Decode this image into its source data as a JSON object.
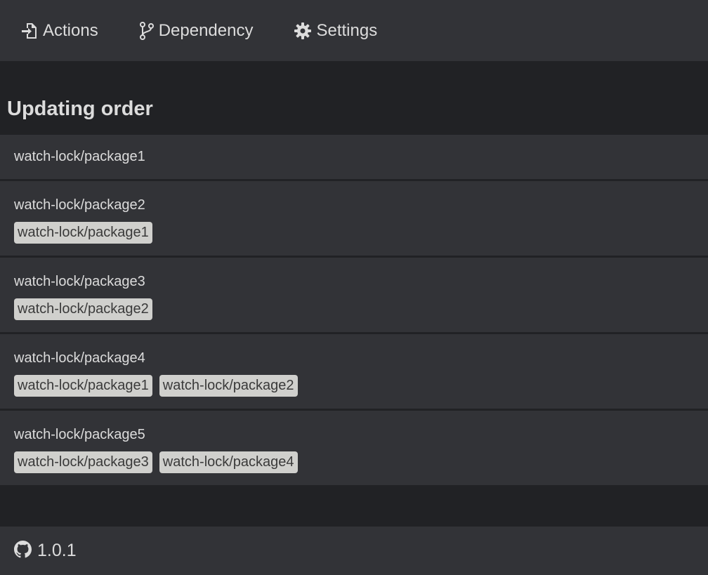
{
  "nav": {
    "items": [
      {
        "label": "Actions",
        "icon": "file-import-icon"
      },
      {
        "label": "Dependency",
        "icon": "code-branch-icon"
      },
      {
        "label": "Settings",
        "icon": "gear-icon"
      }
    ]
  },
  "main": {
    "title": "Updating order",
    "packages": [
      {
        "name": "watch-lock/package1",
        "dependencies": []
      },
      {
        "name": "watch-lock/package2",
        "dependencies": [
          "watch-lock/package1"
        ]
      },
      {
        "name": "watch-lock/package3",
        "dependencies": [
          "watch-lock/package2"
        ]
      },
      {
        "name": "watch-lock/package4",
        "dependencies": [
          "watch-lock/package1",
          "watch-lock/package2"
        ]
      },
      {
        "name": "watch-lock/package5",
        "dependencies": [
          "watch-lock/package3",
          "watch-lock/package4"
        ]
      }
    ]
  },
  "footer": {
    "icon": "github-icon",
    "version": "1.0.1"
  },
  "colors": {
    "background": "#212225",
    "panel": "#323337",
    "text": "#dcdcdc",
    "badge_bg": "#d0d0cd",
    "badge_text": "#3a3a3a"
  }
}
